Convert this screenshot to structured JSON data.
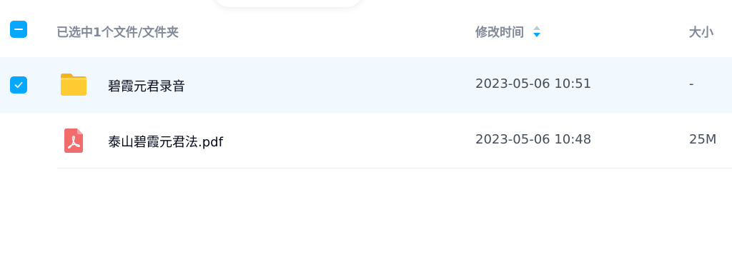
{
  "header": {
    "selection_label": "已选中1个文件/文件夹",
    "col_modified": "修改时间",
    "col_size": "大小",
    "select_all_state": "indeterminate"
  },
  "files": [
    {
      "name": "碧霞元君录音",
      "type": "folder",
      "icon": "folder-icon",
      "modified": "2023-05-06 10:51",
      "size": "-",
      "selected": true
    },
    {
      "name": "泰山碧霞元君法.pdf",
      "type": "pdf",
      "icon": "pdf-icon",
      "modified": "2023-05-06 10:48",
      "size": "25M",
      "selected": false
    }
  ],
  "colors": {
    "accent": "#06a7ff",
    "selected_row_bg": "#f1f8fe",
    "header_text": "#818999",
    "name_text": "#03081a",
    "meta_text": "#454d5a",
    "folder_yellow": "#ffc933",
    "pdf_red": "#f26b6d"
  }
}
